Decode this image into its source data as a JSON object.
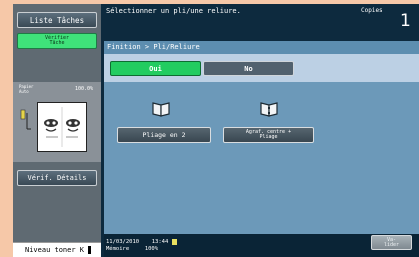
{
  "left": {
    "liste_taches": "Liste Tâches",
    "verifier_line1": "Vérifier",
    "verifier_line2": "Tâche",
    "preview_line1": "Papier",
    "preview_line2": "Auto",
    "preview_zoom": "100.0%",
    "verif_details": "Vérif. Détails",
    "toner": "Niveau toner K"
  },
  "header": {
    "message": "Sélectionner un pli/une reliure.",
    "copies_label": "Copies",
    "copies_value": "1"
  },
  "panel": {
    "title": "Finition > Pli/Reliure",
    "oui": "Oui",
    "non": "No",
    "pliage": "Pliage en 2",
    "agraf_line1": "Agraf. centre +",
    "agraf_line2": "Pliage"
  },
  "footer": {
    "date": "11/03/2010",
    "time": "13:44",
    "memoire_label": "Mémoire",
    "memoire_value": "100%",
    "valider_line1": "Va-",
    "valider_line2": "lider"
  },
  "colors": {
    "accent_green": "#22cc60",
    "title_bar": "#5d8eb0",
    "background": "#0d2a3e"
  }
}
